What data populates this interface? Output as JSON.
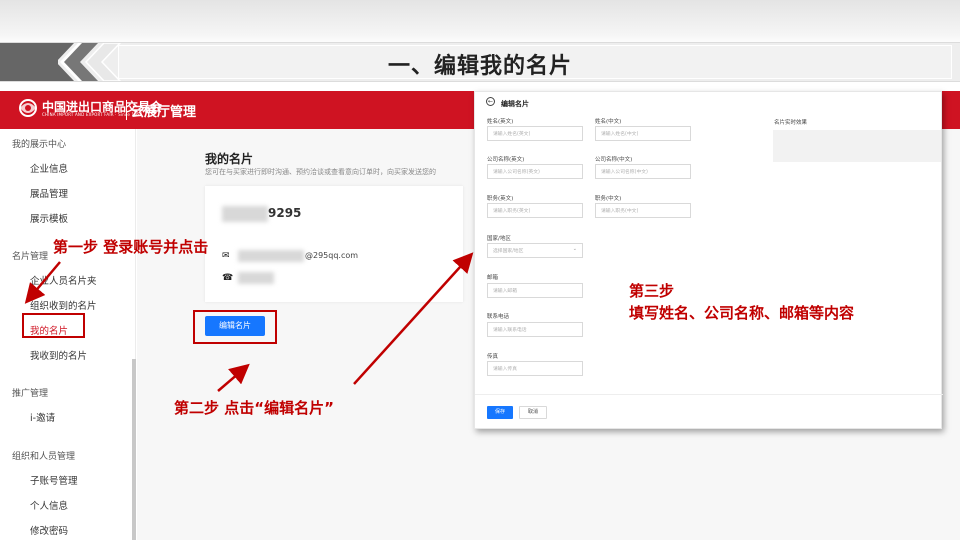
{
  "slide": {
    "title": "一、编辑我的名片"
  },
  "header": {
    "logo_cn": "中国进出口商品交易会",
    "logo_en": "CHINA IMPORT AND EXPORT FAIR · Since 1957",
    "app_title": "云展厅管理"
  },
  "sidebar": {
    "groups": [
      {
        "label": "我的展示中心",
        "items": [
          "企业信息",
          "展品管理",
          "展示模板"
        ]
      },
      {
        "label": "名片管理",
        "items": [
          "企业人员名片夹",
          "组织收到的名片",
          "我的名片",
          "我收到的名片"
        ]
      },
      {
        "label": "推广管理",
        "items": [
          "i-邀请"
        ]
      },
      {
        "label": "组织和人员管理",
        "items": [
          "子账号管理",
          "个人信息",
          "修改密码"
        ]
      }
    ],
    "active_item": "我的名片"
  },
  "card_page": {
    "title": "我的名片",
    "description": "您可在与买家进行即时沟通、预约洽谈或查看意向订单时，向买家发送您的",
    "name_suffix": "9295",
    "email_suffix": "@295qq.com",
    "edit_button": "编辑名片"
  },
  "annotations": {
    "step1": "第一步   登录账号并点击",
    "step2": "第二步   点击“编辑名片”",
    "step3_title": "第三步",
    "step3_body": "填写姓名、公司名称、邮箱等内容"
  },
  "form": {
    "title": "编辑名片",
    "preview_label": "名片实时效果",
    "fields": {
      "name_en": {
        "label": "姓名(英文)",
        "placeholder": "请输入姓名(英文)"
      },
      "name_cn": {
        "label": "姓名(中文)",
        "placeholder": "请输入姓名(中文)"
      },
      "company_en": {
        "label": "公司名称(英文)",
        "placeholder": "请输入公司名称(英文)"
      },
      "company_cn": {
        "label": "公司名称(中文)",
        "placeholder": "请输入公司名称(中文)"
      },
      "position_en": {
        "label": "职务(英文)",
        "placeholder": "请输入职务(英文)"
      },
      "position_cn": {
        "label": "职务(中文)",
        "placeholder": "请输入职务(中文)"
      },
      "country": {
        "label": "国家/地区",
        "placeholder": "选择国家/地区"
      },
      "email": {
        "label": "邮箱",
        "placeholder": "请输入邮箱"
      },
      "phone": {
        "label": "联系电话",
        "placeholder": "请输入联系电话"
      },
      "fax": {
        "label": "传真",
        "placeholder": "请输入传真"
      }
    },
    "save_button": "保存",
    "cancel_button": "取消"
  },
  "colors": {
    "header_red": "#cf1322",
    "annotation_red": "#c00000",
    "primary_blue": "#1677ff"
  }
}
